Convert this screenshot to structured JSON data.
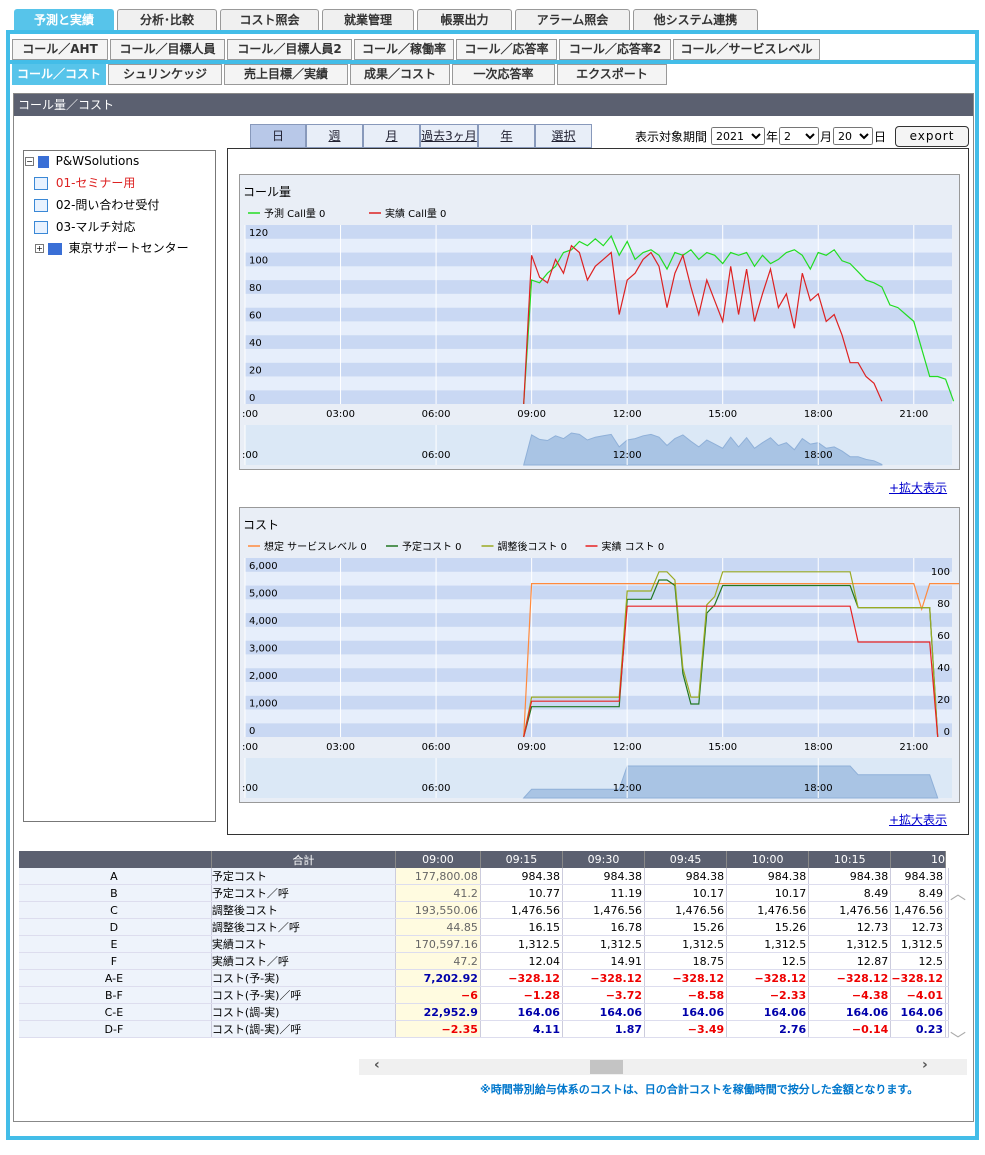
{
  "top_tabs": [
    "予測と実績",
    "分析･比較",
    "コスト照会",
    "就業管理",
    "帳票出力",
    "アラーム照会",
    "他システム連携"
  ],
  "sub_tabs_1": [
    "コール／AHT",
    "コール／目標人員",
    "コール／目標人員2",
    "コール／稼働率",
    "コール／応答率",
    "コール／応答率2",
    "コール／サービスレベル"
  ],
  "sub_tabs_2": [
    "コール／コスト",
    "シュリンケッジ",
    "売上目標／実績",
    "成果／コスト",
    "一次応答率",
    "エクスポート"
  ],
  "panel_title": "コール量／コスト",
  "period_tabs": [
    "日",
    "週",
    "月",
    "過去3ヶ月",
    "年",
    "選択"
  ],
  "period_label": "表示対象期間",
  "year": "2021",
  "year_unit": "年",
  "month": "2",
  "month_unit": "月",
  "day": "20",
  "day_unit": "日",
  "export_label": "export",
  "tree": {
    "root": "P&WSolutions",
    "items": [
      "01-セミナー用",
      "02-問い合わせ受付",
      "03-マルチ対応"
    ],
    "group": "東京サポートセンター"
  },
  "zoom_label": "+拡大表示",
  "note": "※時間帯別給与体系のコストは、日の合計コストを稼働時間で按分した金額となります。",
  "chart_data": [
    {
      "type": "line",
      "title": "コール量",
      "legend": [
        "予測 Call量 0",
        "実績 Call量 0"
      ],
      "colors": [
        "#22dd22",
        "#dd2222"
      ],
      "x_ticks": [
        ":00",
        "03:00",
        "06:00",
        "09:00",
        "12:00",
        "15:00",
        "18:00",
        "21:00"
      ],
      "nav_ticks": [
        ":00",
        "06:00",
        "12:00",
        "18:00"
      ],
      "y_ticks": [
        "0",
        "20",
        "40",
        "60",
        "80",
        "100",
        "120"
      ],
      "ylim": [
        0,
        130
      ],
      "x_start": 8.75,
      "x_step": 0.25,
      "series": [
        {
          "name": "予測 Call量 0",
          "values": [
            0,
            90,
            88,
            95,
            100,
            110,
            112,
            118,
            115,
            120,
            115,
            122,
            108,
            118,
            105,
            110,
            112,
            108,
            98,
            110,
            108,
            112,
            105,
            110,
            108,
            102,
            110,
            108,
            110,
            100,
            108,
            102,
            105,
            110,
            112,
            108,
            98,
            110,
            108,
            112,
            104,
            102,
            96,
            90,
            88,
            85,
            72,
            70,
            65,
            60,
            40,
            20,
            20,
            18,
            2
          ]
        },
        {
          "name": "実績 Call量 0",
          "values": [
            0,
            108,
            92,
            88,
            105,
            95,
            115,
            110,
            90,
            100,
            105,
            110,
            65,
            90,
            95,
            105,
            110,
            100,
            70,
            95,
            108,
            85,
            65,
            90,
            75,
            60,
            100,
            65,
            98,
            60,
            80,
            98,
            70,
            80,
            55,
            95,
            75,
            80,
            60,
            65,
            50,
            30,
            30,
            20,
            15,
            2
          ]
        }
      ]
    },
    {
      "type": "line",
      "title": "コスト",
      "legend": [
        "想定 サービスレベル 0",
        "予定コスト 0",
        "調整後コスト 0",
        "実績 コスト 0"
      ],
      "colors": [
        "#ff8a3d",
        "#227722",
        "#9aaa22",
        "#e82222"
      ],
      "x_ticks": [
        ":00",
        "03:00",
        "06:00",
        "09:00",
        "12:00",
        "15:00",
        "18:00",
        "21:00"
      ],
      "nav_ticks": [
        ":00",
        "06:00",
        "12:00",
        "18:00"
      ],
      "y_ticks": [
        "0",
        "1,000",
        "2,000",
        "3,000",
        "4,000",
        "5,000",
        "6,000"
      ],
      "y2_ticks": [
        "0",
        "20",
        "40",
        "60",
        "80",
        "100"
      ],
      "ylim": [
        0,
        6500
      ],
      "y2lim": [
        0,
        112
      ],
      "x_start": 8.75,
      "x_step": 0.25,
      "series": [
        {
          "name": "想定 サービスレベル 0",
          "axis": 2,
          "values": [
            0,
            96,
            96,
            96,
            96,
            96,
            96,
            96,
            96,
            96,
            96,
            96,
            96,
            96,
            96,
            96,
            96,
            96,
            96,
            96,
            96,
            96,
            96,
            96,
            96,
            96,
            96,
            96,
            96,
            96,
            96,
            96,
            96,
            96,
            96,
            96,
            96,
            96,
            96,
            96,
            96,
            96,
            96,
            96,
            96,
            96,
            96,
            96,
            96,
            96,
            80,
            96,
            96,
            96,
            96,
            96,
            96,
            96,
            96,
            96,
            96,
            96,
            96,
            96,
            96,
            96,
            96,
            96,
            96,
            96,
            96,
            0
          ]
        },
        {
          "name": "予定コスト 0",
          "values": [
            0,
            1100,
            1100,
            1100,
            1100,
            1100,
            1100,
            1100,
            1100,
            1100,
            1100,
            1100,
            1100,
            5000,
            5000,
            5000,
            5000,
            5700,
            5700,
            5500,
            2300,
            1200,
            1200,
            4500,
            4800,
            5500,
            5500,
            5500,
            5500,
            5500,
            5500,
            5500,
            5500,
            5500,
            5500,
            5500,
            5500,
            5500,
            5500,
            5500,
            5500,
            5500,
            4700,
            4700,
            4700,
            4700,
            4700,
            4700,
            4700,
            4700,
            4700,
            4700,
            0
          ]
        },
        {
          "name": "調整後コスト 0",
          "values": [
            0,
            1450,
            1450,
            1450,
            1450,
            1450,
            1450,
            1450,
            1450,
            1450,
            1450,
            1450,
            1450,
            5300,
            5300,
            5300,
            5300,
            6000,
            6000,
            5700,
            2500,
            1450,
            1450,
            4800,
            5100,
            6000,
            6000,
            6000,
            6000,
            6000,
            6000,
            6000,
            6000,
            6000,
            6000,
            6000,
            6000,
            6000,
            6000,
            6000,
            6000,
            6000,
            4700,
            4700,
            4700,
            4700,
            4700,
            4700,
            4700,
            4700,
            4700,
            4700,
            0
          ]
        },
        {
          "name": "実績 コスト 0",
          "values": [
            0,
            1300,
            1300,
            1300,
            1300,
            1300,
            1300,
            1300,
            1300,
            1300,
            1300,
            1300,
            1300,
            4750,
            4750,
            4750,
            4750,
            4750,
            4750,
            4750,
            4750,
            4750,
            4750,
            4750,
            4750,
            4750,
            4750,
            4750,
            4750,
            4750,
            4750,
            4750,
            4750,
            4750,
            4750,
            4750,
            4750,
            4750,
            4750,
            4750,
            4750,
            4750,
            3450,
            3450,
            3450,
            3450,
            3450,
            3450,
            3450,
            3450,
            3450,
            3450,
            0
          ]
        }
      ]
    }
  ],
  "table": {
    "headers": [
      "合計",
      "09:00",
      "09:15",
      "09:30",
      "09:45",
      "10:00",
      "10:15",
      "10"
    ],
    "rows": [
      {
        "code": "A",
        "label": "予定コスト",
        "total": "177,800.08",
        "vals": [
          "984.38",
          "984.38",
          "984.38",
          "984.38",
          "984.38",
          "984.38"
        ],
        "style": "normal"
      },
      {
        "code": "B",
        "label": "予定コスト／呼",
        "total": "41.2",
        "vals": [
          "10.77",
          "11.19",
          "10.17",
          "10.17",
          "8.49",
          "8.49"
        ],
        "style": "normal"
      },
      {
        "code": "C",
        "label": "調整後コスト",
        "total": "193,550.06",
        "vals": [
          "1,476.56",
          "1,476.56",
          "1,476.56",
          "1,476.56",
          "1,476.56",
          "1,476.56"
        ],
        "style": "normal"
      },
      {
        "code": "D",
        "label": "調整後コスト／呼",
        "total": "44.85",
        "vals": [
          "16.15",
          "16.78",
          "15.26",
          "15.26",
          "12.73",
          "12.73"
        ],
        "style": "normal"
      },
      {
        "code": "E",
        "label": "実績コスト",
        "total": "170,597.16",
        "vals": [
          "1,312.5",
          "1,312.5",
          "1,312.5",
          "1,312.5",
          "1,312.5",
          "1,312.5"
        ],
        "style": "normal"
      },
      {
        "code": "F",
        "label": "実績コスト／呼",
        "total": "47.2",
        "vals": [
          "12.04",
          "14.91",
          "18.75",
          "12.5",
          "12.87",
          "12.5"
        ],
        "style": "normal"
      },
      {
        "code": "A-E",
        "label": "コスト(予-実)",
        "total": "7,202.92",
        "vals": [
          "−328.12",
          "−328.12",
          "−328.12",
          "−328.12",
          "−328.12",
          "−328.12"
        ],
        "style": "ae"
      },
      {
        "code": "B-F",
        "label": "コスト(予-実)／呼",
        "total": "−6",
        "vals": [
          "−1.28",
          "−3.72",
          "−8.58",
          "−2.33",
          "−4.38",
          "−4.01"
        ],
        "style": "bf"
      },
      {
        "code": "C-E",
        "label": "コスト(調-実)",
        "total": "22,952.9",
        "vals": [
          "164.06",
          "164.06",
          "164.06",
          "164.06",
          "164.06",
          "164.06"
        ],
        "style": "ce"
      },
      {
        "code": "D-F",
        "label": "コスト(調-実)／呼",
        "total": "−2.35",
        "vals": [
          "4.11",
          "1.87",
          "−3.49",
          "2.76",
          "−0.14",
          "0.23"
        ],
        "style": "df"
      }
    ]
  }
}
